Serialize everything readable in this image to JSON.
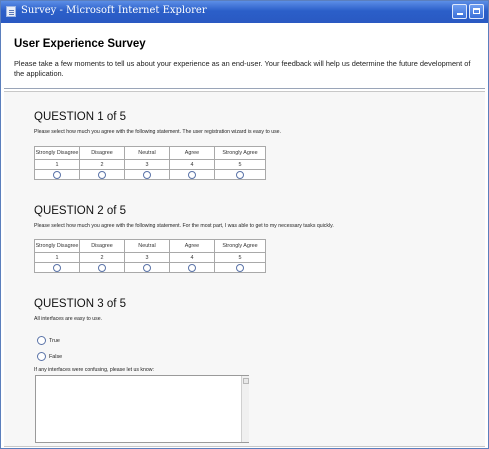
{
  "window": {
    "title": "Survey - Microsoft Internet Explorer",
    "icon": "ie-page-icon"
  },
  "survey": {
    "title": "User Experience Survey",
    "intro": "Please take a few moments to tell us about your experience as an end-user. Your feedback will help us determine the future development of the application."
  },
  "scale": {
    "labels": [
      "Strongly Disagree",
      "Disagree",
      "Neutral",
      "Agree",
      "Strongly Agree"
    ],
    "values": [
      "1",
      "2",
      "3",
      "4",
      "5"
    ]
  },
  "questions": [
    {
      "title": "QUESTION 1 of 5",
      "text": "Please select how much you agree with the following statement. The user registration wizard is easy to use."
    },
    {
      "title": "QUESTION 2 of 5",
      "text": "Please select how much you agree with the following statement. For the most part, I was able to get to my necessary tasks quickly."
    },
    {
      "title": "QUESTION 3 of 5",
      "text": "All interfaces are easy to use.",
      "options": [
        "True",
        "False"
      ],
      "feedback_label": "If any interfaces were confusing, please let us know:",
      "feedback_value": ""
    }
  ],
  "colors": {
    "titlebar": "#2b5fc9",
    "window_border": "#5b7fbd"
  }
}
